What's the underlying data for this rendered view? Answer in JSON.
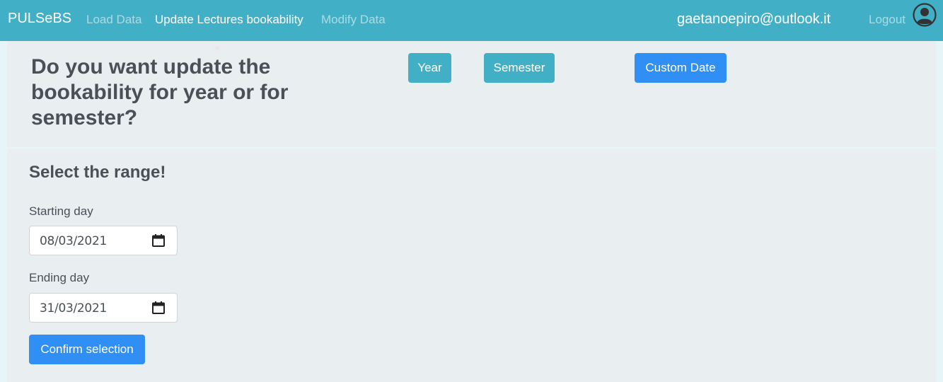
{
  "navbar": {
    "brand": "PULSeBS",
    "links": [
      "Load Data",
      "Update Lectures bookability",
      "Modify Data"
    ],
    "email": "gaetanoepiro@outlook.it",
    "logout": "Logout",
    "avatar_icon": "user-circle-icon",
    "bg_color": "#41b0c6"
  },
  "question": {
    "text": "Do you want update the bookability for year or for semester?",
    "buttons": {
      "year": "Year",
      "semester": "Semester",
      "custom": "Custom Date"
    }
  },
  "range": {
    "title": "Select the range!",
    "start_label": "Starting day",
    "start_value": "08/03/2021",
    "end_label": "Ending day",
    "end_value": "31/03/2021",
    "confirm": "Confirm selection"
  },
  "colors": {
    "info": "#41b0c6",
    "primary": "#2f8ff5",
    "card": "#e9eef0"
  }
}
